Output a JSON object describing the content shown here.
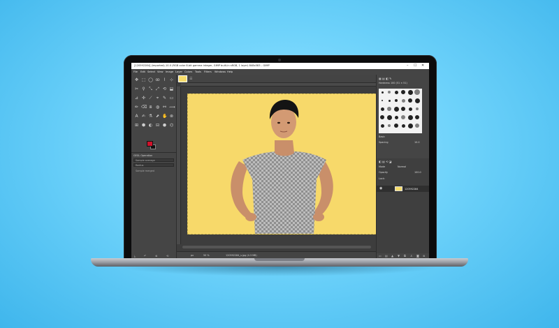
{
  "window": {
    "title": "[120592284] (imported)-10.0 (RGB color 8-bit gamma integer, GIMP built-in sRGB, 1 layer) 848x583 – GIMP",
    "controls": [
      "–",
      "☐",
      "✕"
    ]
  },
  "menu": [
    "File",
    "Edit",
    "Select",
    "View",
    "Image",
    "Layer",
    "Colors",
    "Tools",
    "Filters",
    "Windows",
    "Help"
  ],
  "toolbox": {
    "tools": [
      "✥",
      "⬚",
      "◯",
      "ꝏ",
      "⌇",
      "⊹",
      "✂",
      "⚲",
      "⤡",
      "⤢",
      "⟲",
      "⬓",
      "⊿",
      "✣",
      "⟋",
      "⌖",
      "✎",
      "▭",
      "✏",
      "⌫",
      "⧈",
      "◍",
      "⚯",
      "⟿",
      "A",
      "✍",
      "⚗",
      "⬈",
      "✋",
      "⊗",
      "⊞",
      "⬢",
      "◐",
      "⊟",
      "⬣",
      "⌬"
    ],
    "fg_color": "#d0122b",
    "bg_color": "#111111"
  },
  "tool_options": {
    "title": "GEGL Operation",
    "row1": "Sample average",
    "row2": "Radius",
    "row3": "Sample merged"
  },
  "canvas": {
    "background_color": "#f7d96a",
    "status_unit": "px",
    "status_zoom": "50 %",
    "status_file": "120592284_s.jpg (4.3 MB)"
  },
  "brushes": {
    "header": "Hardness 100 (51 × 51)",
    "preset": "Basic",
    "spacing_label": "Spacing",
    "spacing_value": "10.0"
  },
  "layers": {
    "mode_label": "Mode",
    "mode_value": "Normal",
    "opacity_label": "Opacity",
    "opacity_value": "100.0",
    "lock_label": "Lock:",
    "layer_name": "120592284"
  }
}
